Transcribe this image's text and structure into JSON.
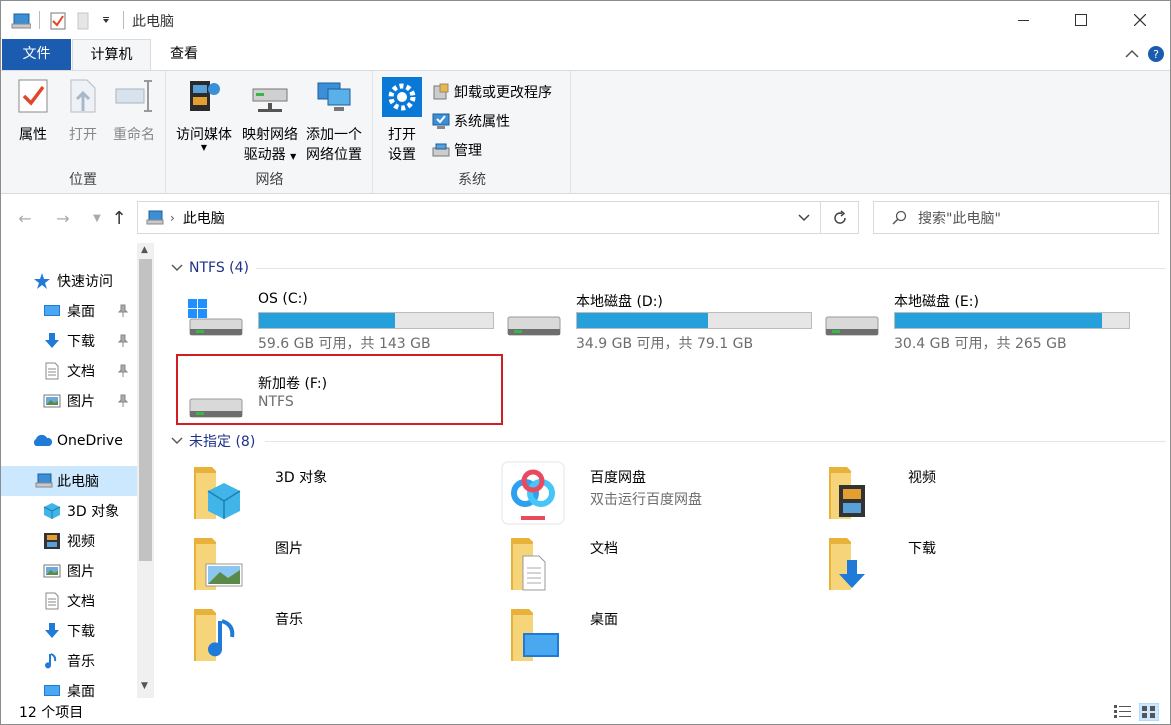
{
  "window": {
    "title": "此电脑",
    "colors": {
      "accent": "#1b5cb0",
      "drive_bar": "#26a0da",
      "selection": "#cce8ff",
      "highlight_box": "#d01e22"
    }
  },
  "ribbon": {
    "tabs": {
      "file": "文件",
      "computer": "计算机",
      "view": "查看"
    },
    "groups": {
      "location": {
        "label": "位置",
        "properties": "属性",
        "open": "打开",
        "rename": "重命名"
      },
      "network": {
        "label": "网络",
        "access_media": "访问媒体",
        "map_drive_line1": "映射网络",
        "map_drive_line2": "驱动器",
        "add_location_line1": "添加一个",
        "add_location_line2": "网络位置"
      },
      "system": {
        "label": "系统",
        "open_settings_line1": "打开",
        "open_settings_line2": "设置",
        "uninstall": "卸载或更改程序",
        "system_properties": "系统属性",
        "manage": "管理"
      }
    }
  },
  "address": {
    "path": "此电脑",
    "search_placeholder": "搜索\"此电脑\""
  },
  "sidebar": {
    "quick_access": "快速访问",
    "pinned": [
      "桌面",
      "下载",
      "文档",
      "图片"
    ],
    "onedrive": "OneDrive",
    "this_pc": "此电脑",
    "this_pc_items": [
      "3D 对象",
      "视频",
      "图片",
      "文档",
      "下载",
      "音乐",
      "桌面"
    ]
  },
  "sections": {
    "drives_header": "NTFS (4)",
    "folders_header": "未指定 (8)"
  },
  "drives": [
    {
      "name": "OS (C:)",
      "info": "59.6 GB 可用，共 143 GB",
      "used_fraction": 0.583
    },
    {
      "name": "本地磁盘 (D:)",
      "info": "34.9 GB 可用，共 79.1 GB",
      "used_fraction": 0.559
    },
    {
      "name": "本地磁盘 (E:)",
      "info": "30.4 GB 可用，共 265 GB",
      "used_fraction": 0.885
    },
    {
      "name": "新加卷 (F:)",
      "info": "NTFS"
    }
  ],
  "folders": [
    {
      "name": "3D 对象",
      "icon": "3d-objects-folder-icon"
    },
    {
      "name": "百度网盘",
      "sub": "双击运行百度网盘",
      "icon": "baidu-netdisk-icon"
    },
    {
      "name": "视频",
      "icon": "videos-folder-icon"
    },
    {
      "name": "图片",
      "icon": "pictures-folder-icon"
    },
    {
      "name": "文档",
      "icon": "documents-folder-icon"
    },
    {
      "name": "下载",
      "icon": "downloads-folder-icon"
    },
    {
      "name": "音乐",
      "icon": "music-folder-icon"
    },
    {
      "name": "桌面",
      "icon": "desktop-folder-icon"
    }
  ],
  "status": {
    "count": "12 个项目"
  }
}
